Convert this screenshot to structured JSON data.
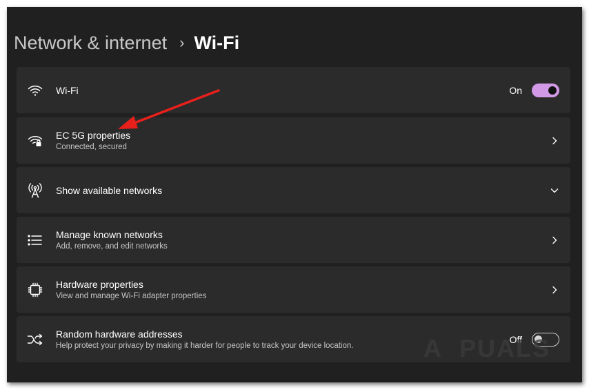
{
  "breadcrumb": {
    "parent": "Network & internet",
    "separator": "›",
    "current": "Wi-Fi"
  },
  "cards": [
    {
      "icon": "wifi-icon",
      "title": "Wi-Fi",
      "state": "On",
      "toggle": "on"
    },
    {
      "icon": "wifi-secured-icon",
      "title": "EC 5G properties",
      "subtitle": "Connected, secured",
      "action": "chevron-right"
    },
    {
      "icon": "antenna-icon",
      "title": "Show available networks",
      "action": "chevron-down"
    },
    {
      "icon": "list-icon",
      "title": "Manage known networks",
      "subtitle": "Add, remove, and edit networks",
      "action": "chevron-right"
    },
    {
      "icon": "chip-icon",
      "title": "Hardware properties",
      "subtitle": "View and manage Wi-Fi adapter properties",
      "action": "chevron-right"
    },
    {
      "icon": "shuffle-icon",
      "title": "Random hardware addresses",
      "subtitle": "Help protect your privacy by making it harder for people to track your device location.",
      "state": "Off",
      "toggle": "off"
    }
  ],
  "colors": {
    "window_bg": "#202020",
    "card_bg": "#2b2b2b",
    "accent": "#d29ae6",
    "annotation_arrow": "#e8201c"
  },
  "watermark": "A  PUALS"
}
